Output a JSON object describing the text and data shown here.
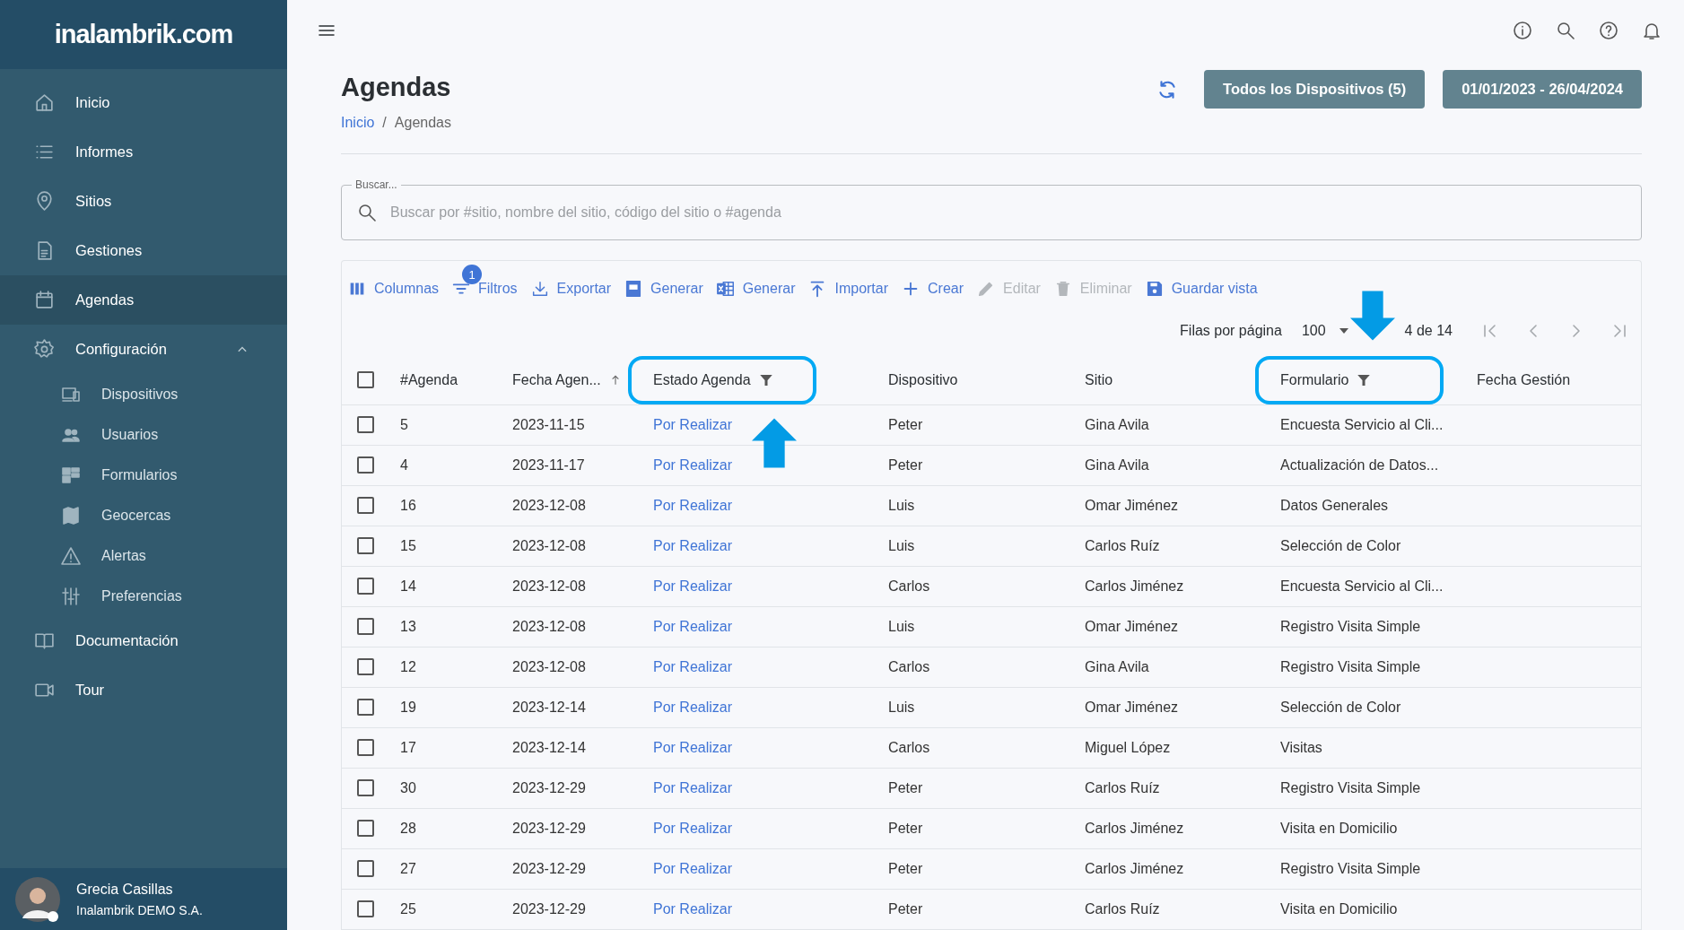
{
  "sidebar": {
    "logo": "inalambrik.com",
    "items": [
      {
        "label": "Inicio",
        "selected": false
      },
      {
        "label": "Informes",
        "selected": false
      },
      {
        "label": "Sitios",
        "selected": false
      },
      {
        "label": "Gestiones",
        "selected": false
      },
      {
        "label": "Agendas",
        "selected": true
      },
      {
        "label": "Configuración",
        "selected": false,
        "expanded": true,
        "children": [
          {
            "label": "Dispositivos",
            "selected": false
          },
          {
            "label": "Usuarios",
            "selected": false
          },
          {
            "label": "Formularios",
            "selected": false
          },
          {
            "label": "Geocercas",
            "selected": false
          },
          {
            "label": "Alertas",
            "selected": false
          },
          {
            "label": "Preferencias",
            "selected": false
          }
        ]
      },
      {
        "label": "Documentación",
        "selected": false
      },
      {
        "label": "Tour",
        "selected": false
      }
    ],
    "user": {
      "name": "Grecia Casillas",
      "company": "Inalambrik DEMO S.A."
    }
  },
  "page": {
    "title": "Agendas",
    "breadcrumb": [
      "Inicio",
      "Agendas"
    ],
    "breadcrumb_separator": "/",
    "buttons": [
      "Todos los Dispositivos (5)",
      "01/01/2023 - 26/04/2024"
    ]
  },
  "search": {
    "label": "Buscar...",
    "placeholder": "Buscar por #sitio, nombre del sitio, código del sitio o #agenda"
  },
  "toolbar": [
    {
      "label": "Columnas",
      "disabled": false
    },
    {
      "label": "Filtros",
      "disabled": false,
      "badge": "1"
    },
    {
      "label": "Exportar",
      "disabled": false
    },
    {
      "label": "Generar",
      "disabled": false
    },
    {
      "label": "Generar",
      "disabled": false
    },
    {
      "label": "Importar",
      "disabled": false
    },
    {
      "label": "Crear",
      "disabled": false
    },
    {
      "label": "Editar",
      "disabled": true
    },
    {
      "label": "Eliminar",
      "disabled": true
    },
    {
      "label": "Guardar vista",
      "disabled": false
    }
  ],
  "pagination": {
    "rows_label": "Filas por página",
    "rows_per_page": "100",
    "range": "4 de 14"
  },
  "table": {
    "select_all_checked": false,
    "columns": [
      {
        "label": "#Agenda",
        "highlighted": false
      },
      {
        "label": "Fecha Agen...",
        "highlighted": false,
        "sorted": true
      },
      {
        "label": "Estado Agenda",
        "highlighted": true,
        "filtered": true,
        "pointer_below": true
      },
      {
        "label": "Dispositivo",
        "highlighted": false
      },
      {
        "label": "Sitio",
        "highlighted": false
      },
      {
        "label": "Formulario",
        "highlighted": true,
        "filtered": true,
        "pointer_above": true
      },
      {
        "label": "Fecha Gestión",
        "highlighted": false
      }
    ],
    "rows": [
      {
        "checked": false,
        "cells": [
          "5",
          "2023-11-15",
          "Por Realizar",
          "Peter",
          "Gina Avila",
          "Encuesta Servicio al Cli..."
        ]
      },
      {
        "checked": false,
        "cells": [
          "4",
          "2023-11-17",
          "Por Realizar",
          "Peter",
          "Gina Avila",
          "Actualización de Datos..."
        ]
      },
      {
        "checked": false,
        "cells": [
          "16",
          "2023-12-08",
          "Por Realizar",
          "Luis",
          "Omar Jiménez",
          "Datos Generales"
        ]
      },
      {
        "checked": false,
        "cells": [
          "15",
          "2023-12-08",
          "Por Realizar",
          "Luis",
          "Carlos Ruíz",
          "Selección de Color"
        ]
      },
      {
        "checked": false,
        "cells": [
          "14",
          "2023-12-08",
          "Por Realizar",
          "Carlos",
          "Carlos Jiménez",
          "Encuesta Servicio al Cli..."
        ]
      },
      {
        "checked": false,
        "cells": [
          "13",
          "2023-12-08",
          "Por Realizar",
          "Luis",
          "Omar Jiménez",
          "Registro Visita Simple"
        ]
      },
      {
        "checked": false,
        "cells": [
          "12",
          "2023-12-08",
          "Por Realizar",
          "Carlos",
          "Gina Avila",
          "Registro Visita Simple"
        ]
      },
      {
        "checked": false,
        "cells": [
          "19",
          "2023-12-14",
          "Por Realizar",
          "Luis",
          "Omar Jiménez",
          "Selección de Color"
        ]
      },
      {
        "checked": false,
        "cells": [
          "17",
          "2023-12-14",
          "Por Realizar",
          "Carlos",
          "Miguel López",
          "Visitas"
        ]
      },
      {
        "checked": false,
        "cells": [
          "30",
          "2023-12-29",
          "Por Realizar",
          "Peter",
          "Carlos Ruíz",
          "Registro Visita Simple"
        ]
      },
      {
        "checked": false,
        "cells": [
          "28",
          "2023-12-29",
          "Por Realizar",
          "Peter",
          "Carlos Jiménez",
          "Visita en Domicilio"
        ]
      },
      {
        "checked": false,
        "cells": [
          "27",
          "2023-12-29",
          "Por Realizar",
          "Peter",
          "Carlos Jiménez",
          "Registro Visita Simple"
        ]
      },
      {
        "checked": false,
        "cells": [
          "25",
          "2023-12-29",
          "Por Realizar",
          "Peter",
          "Carlos Ruíz",
          "Visita en Domicilio"
        ]
      }
    ]
  }
}
